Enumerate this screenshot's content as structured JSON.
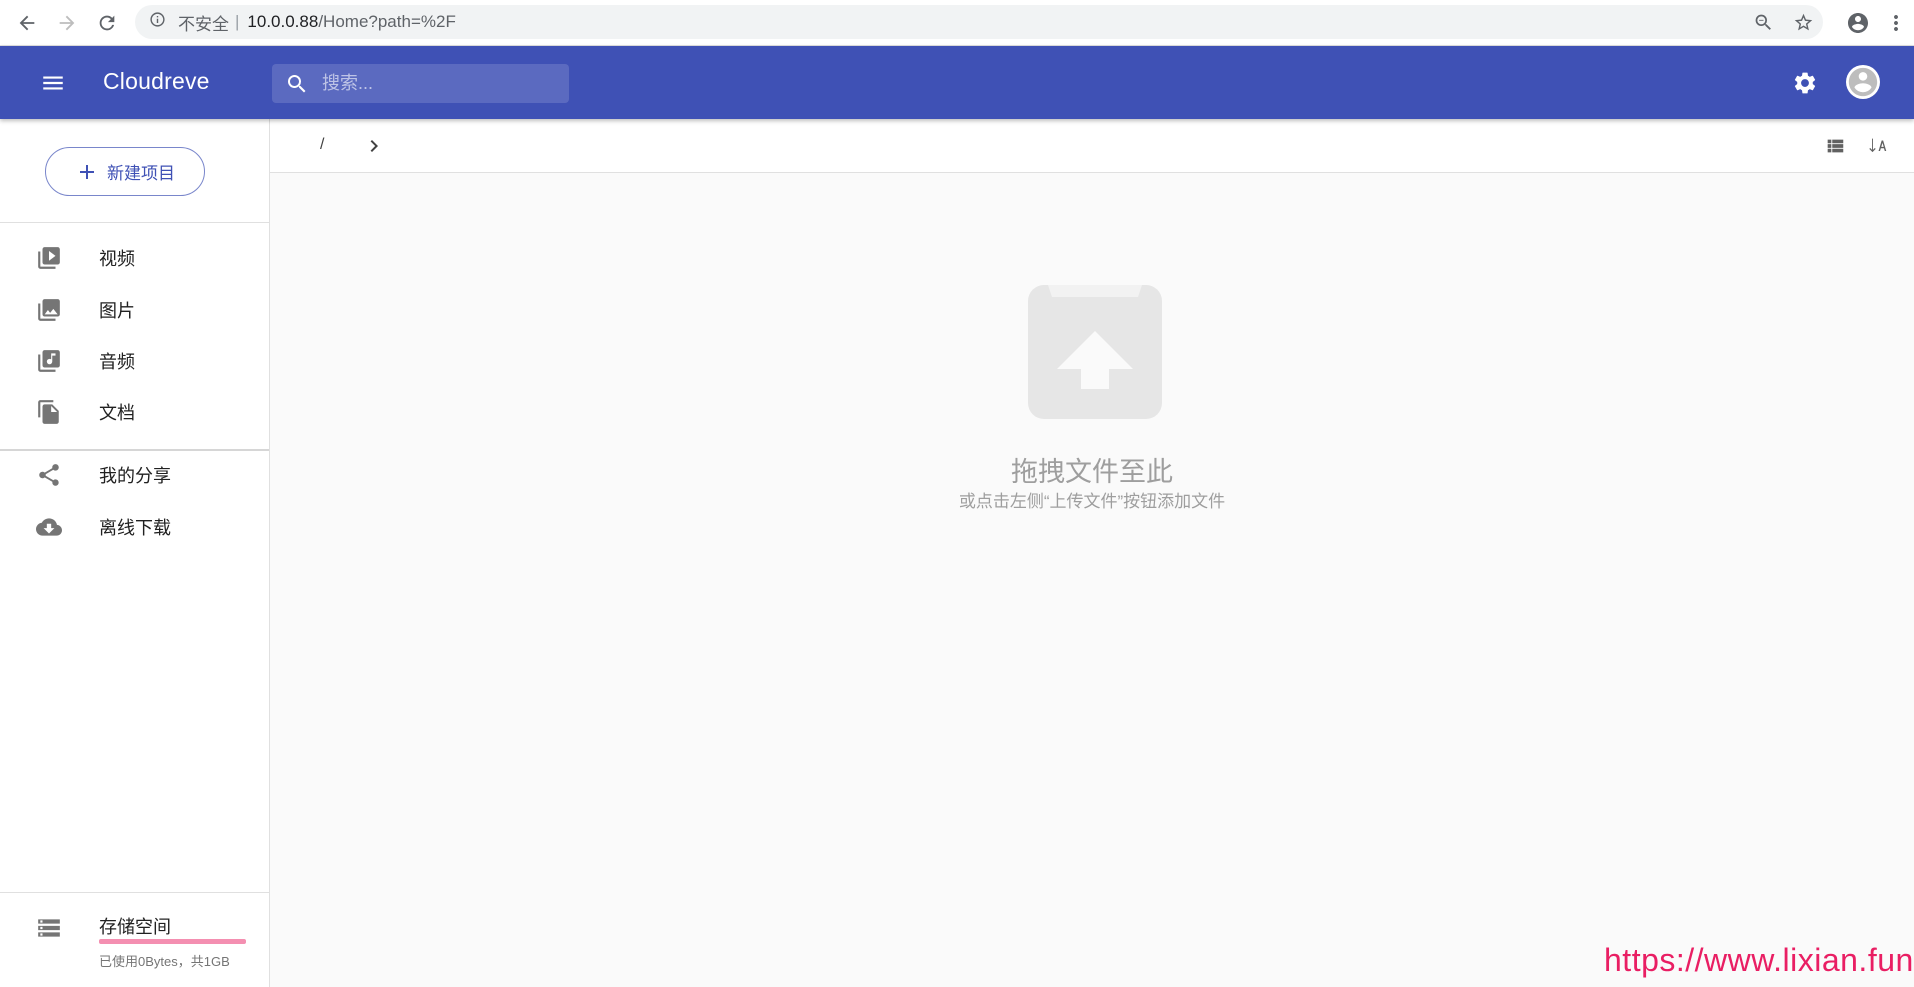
{
  "browser": {
    "security_label": "不安全",
    "separator": "|",
    "url_host": "10.0.0.88",
    "url_path": "/Home?path=%2F"
  },
  "appbar": {
    "title": "Cloudreve",
    "search_placeholder": "搜索..."
  },
  "sidebar": {
    "new_button_label": "新建项目",
    "items": [
      {
        "label": "视频",
        "icon": "video-library-icon"
      },
      {
        "label": "图片",
        "icon": "photo-library-icon"
      },
      {
        "label": "音频",
        "icon": "library-music-icon"
      },
      {
        "label": "文档",
        "icon": "file-copy-icon"
      },
      {
        "label": "我的分享",
        "icon": "share-icon"
      },
      {
        "label": "离线下载",
        "icon": "cloud-download-icon"
      }
    ],
    "storage": {
      "title": "存储空间",
      "info": "已使用0Bytes，共1GB",
      "used_fraction": 0
    }
  },
  "main": {
    "path_root": "/",
    "empty_title": "拖拽文件至此",
    "empty_subtitle": "或点击左侧“上传文件”按钮添加文件"
  },
  "watermark": "https://www.lixian.fun",
  "colors": {
    "primary": "#3f51b5",
    "accent": "#e91e63"
  }
}
